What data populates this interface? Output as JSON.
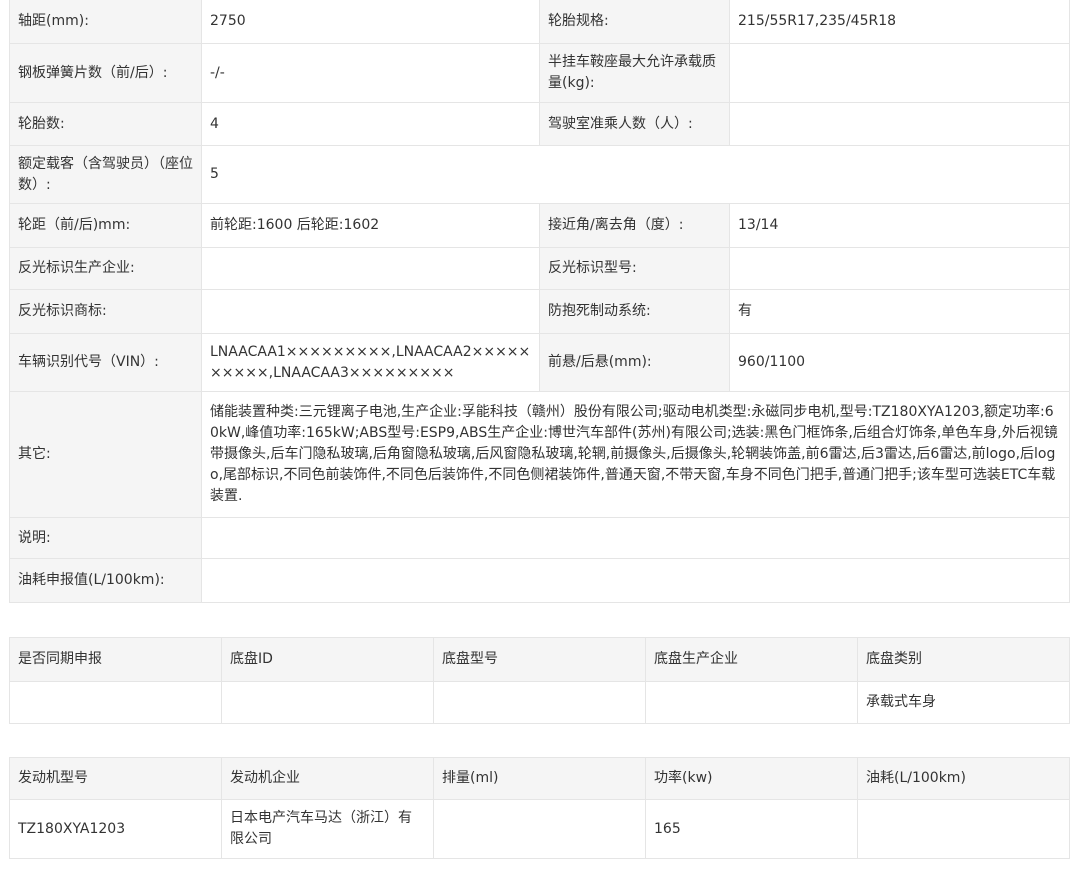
{
  "params": {
    "wheelbase_label": "轴距(mm):",
    "wheelbase_value": "2750",
    "tire_spec_label": "轮胎规格:",
    "tire_spec_value": "215/55R17,235/45R18",
    "leaf_spring_label": "钢板弹簧片数（前/后）:",
    "leaf_spring_value": "-/-",
    "saddle_label": "半挂车鞍座最大允许承载质量(kg):",
    "saddle_value": "",
    "tire_count_label": "轮胎数:",
    "tire_count_value": "4",
    "cab_passengers_label": "驾驶室准乘人数（人）:",
    "cab_passengers_value": "",
    "rated_passengers_label": "额定载客（含驾驶员）（座位数）:",
    "rated_passengers_value": "5",
    "track_label": "轮距（前/后)mm:",
    "track_value": "前轮距:1600 后轮距:1602",
    "angle_label": "接近角/离去角（度）:",
    "angle_value": "13/14",
    "reflector_maker_label": "反光标识生产企业:",
    "reflector_maker_value": "",
    "reflector_model_label": "反光标识型号:",
    "reflector_model_value": "",
    "reflector_brand_label": "反光标识商标:",
    "reflector_brand_value": "",
    "abs_label": "防抱死制动系统:",
    "abs_value": "有",
    "vin_label": "车辆识别代号（VIN）:",
    "vin_value": "LNAACAA1×××××××××,LNAACAA2××××××××××,LNAACAA3×××××××××",
    "overhang_label": "前悬/后悬(mm):",
    "overhang_value": "960/1100",
    "other_label": "其它:",
    "other_value": "储能装置种类:三元锂离子电池,生产企业:孚能科技（赣州）股份有限公司;驱动电机类型:永磁同步电机,型号:TZ180XYA1203,额定功率:60kW,峰值功率:165kW;ABS型号:ESP9,ABS生产企业:博世汽车部件(苏州)有限公司;选装:黑色门框饰条,后组合灯饰条,单色车身,外后视镜带摄像头,后车门隐私玻璃,后角窗隐私玻璃,后风窗隐私玻璃,轮辋,前摄像头,后摄像头,轮辋装饰盖,前6雷达,后3雷达,后6雷达,前logo,后logo,尾部标识,不同色前装饰件,不同色后装饰件,不同色侧裙装饰件,普通天窗,不带天窗,车身不同色门把手,普通门把手;该车型可选装ETC车载装置.",
    "note_label": "说明:",
    "note_value": "",
    "fuel_label": "油耗申报值(L/100km):",
    "fuel_value": ""
  },
  "chassis": {
    "headers": [
      "是否同期申报",
      "底盘ID",
      "底盘型号",
      "底盘生产企业",
      "底盘类别"
    ],
    "row": [
      "",
      "",
      "",
      "",
      "承载式车身"
    ]
  },
  "engine": {
    "headers": [
      "发动机型号",
      "发动机企业",
      "排量(ml)",
      "功率(kw)",
      "油耗(L/100km)"
    ],
    "row": [
      "TZ180XYA1203",
      "日本电产汽车马达（浙江）有限公司",
      "",
      "165",
      ""
    ]
  }
}
